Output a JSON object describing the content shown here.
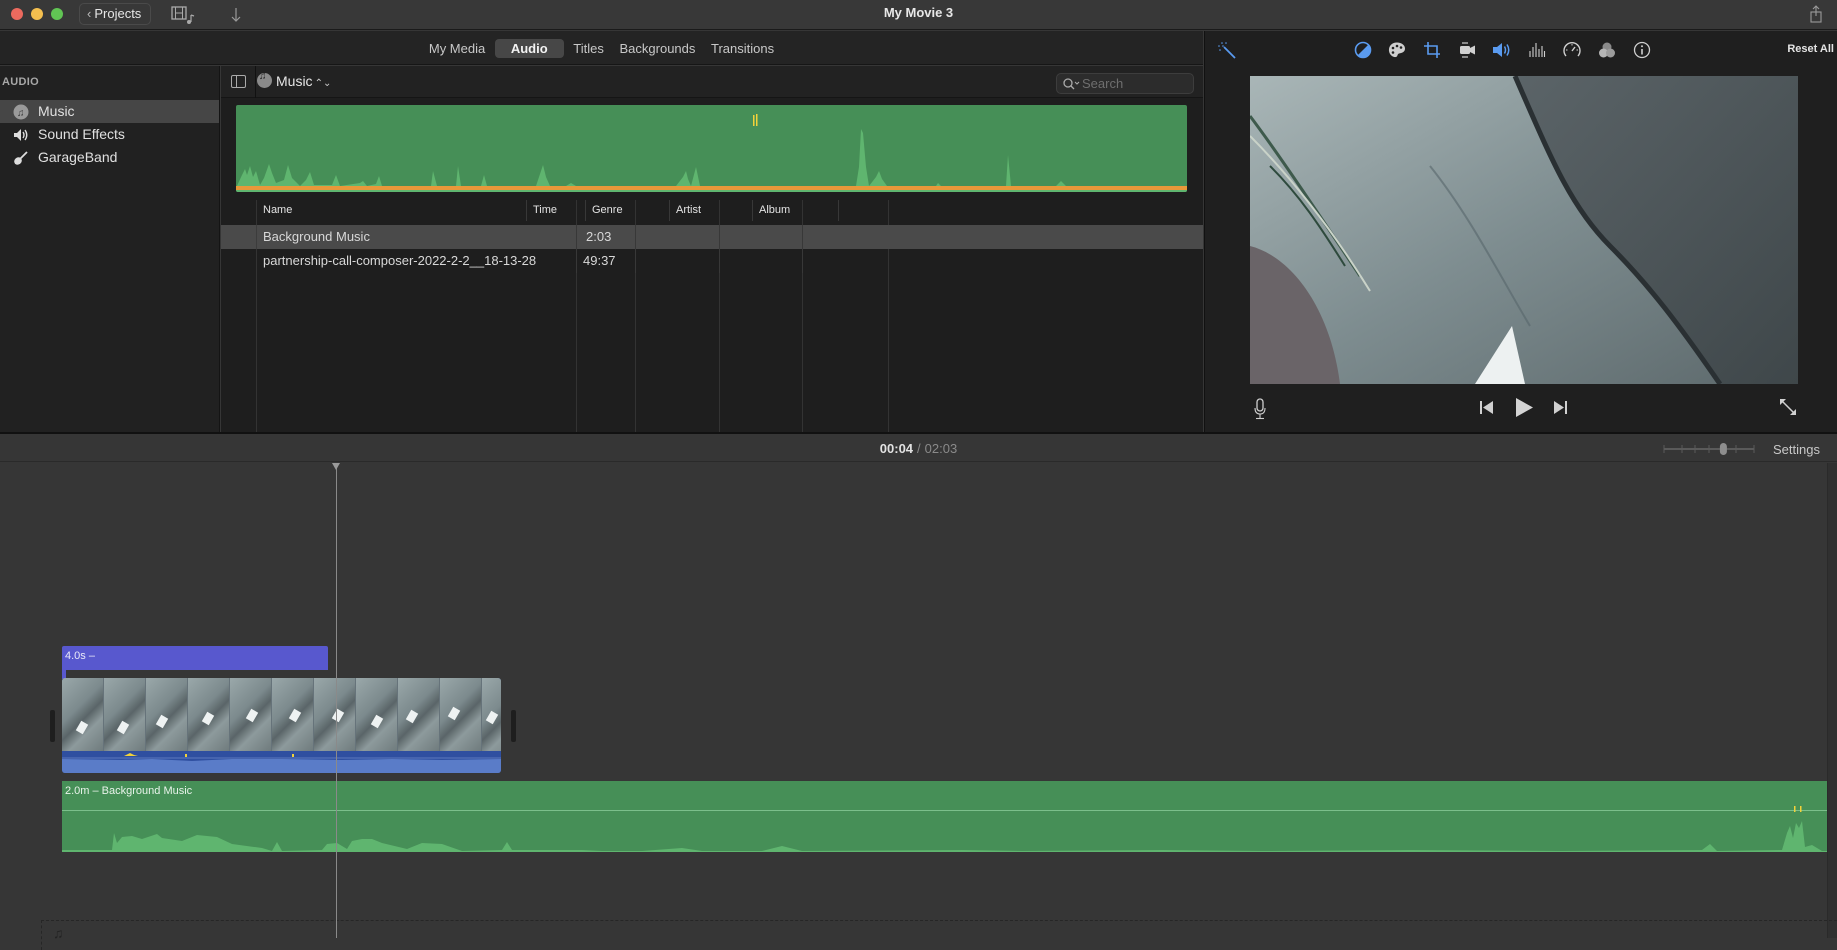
{
  "window": {
    "title": "My Movie 3",
    "projects_button": "Projects"
  },
  "browser": {
    "tabs": [
      {
        "label": "My Media",
        "active": false
      },
      {
        "label": "Audio",
        "active": true
      },
      {
        "label": "Titles",
        "active": false
      },
      {
        "label": "Backgrounds",
        "active": false
      },
      {
        "label": "Transitions",
        "active": false
      }
    ]
  },
  "sidebar": {
    "heading": "AUDIO",
    "items": [
      {
        "label": "Music",
        "icon": "music-note-icon",
        "selected": true
      },
      {
        "label": "Sound Effects",
        "icon": "speaker-icon",
        "selected": false
      },
      {
        "label": "GarageBand",
        "icon": "guitar-icon",
        "selected": false
      }
    ]
  },
  "library": {
    "source_dropdown": "Music",
    "search": {
      "placeholder": "Search",
      "value": ""
    },
    "columns": [
      "Name",
      "Time",
      "Genre",
      "Artist",
      "Album"
    ],
    "rows": [
      {
        "name": "Background Music",
        "time": "2:03",
        "genre": "",
        "artist": "",
        "album": "",
        "selected": true
      },
      {
        "name": "partnership-call-composer-2022-2-2__18-13-28",
        "time": "49:37",
        "genre": "",
        "artist": "",
        "album": "",
        "selected": false
      }
    ]
  },
  "viewer": {
    "toolbar_icons": [
      "magic-wand-icon",
      "color-balance-icon",
      "color-correction-icon",
      "crop-icon",
      "stabilization-icon",
      "volume-icon",
      "noise-reduction-icon",
      "speed-icon",
      "filter-icon",
      "info-icon"
    ],
    "active_tool": "volume-icon",
    "reset_all": "Reset All"
  },
  "timeline": {
    "current_time": "00:04",
    "separator": "/",
    "total_time": "02:03",
    "settings_label": "Settings",
    "zoom_level_fraction": 0.66,
    "title_clip_label": "4.0s –",
    "music_clip_label": "2.0m – Background Music"
  },
  "colors": {
    "audio_green": "#468f57",
    "waveform_green": "#5fb56f",
    "title_purple": "#5858ce",
    "video_blue": "#4c6fb7",
    "accent_blue": "#5a9bf0",
    "peak_yellow": "#f2d23a",
    "selection_orange": "#e8983a"
  }
}
